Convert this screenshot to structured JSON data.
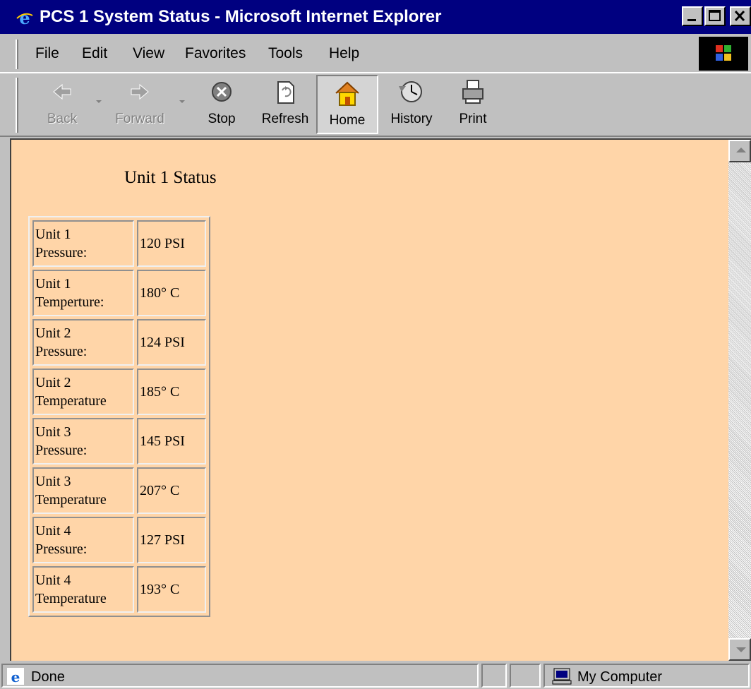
{
  "window": {
    "title": "PCS 1 System Status - Microsoft Internet Explorer"
  },
  "menu": [
    {
      "label": "File"
    },
    {
      "label": "Edit"
    },
    {
      "label": "View"
    },
    {
      "label": "Favorites"
    },
    {
      "label": "Tools"
    },
    {
      "label": "Help"
    }
  ],
  "toolbar": {
    "back": "Back",
    "forward": "Forward",
    "stop": "Stop",
    "refresh": "Refresh",
    "home": "Home",
    "history": "History",
    "print": "Print"
  },
  "page": {
    "heading": "Unit 1 Status",
    "background": "#ffd5a8",
    "rows": [
      {
        "label_line1": "Unit 1",
        "label_line2": "Pressure:",
        "value": "120 PSI"
      },
      {
        "label_line1": "Unit 1",
        "label_line2": "Temperture:",
        "value": "180° C"
      },
      {
        "label_line1": "Unit 2",
        "label_line2": "Pressure:",
        "value": "124 PSI"
      },
      {
        "label_line1": "Unit 2",
        "label_line2": "Temperature",
        "value": "185° C"
      },
      {
        "label_line1": "Unit 3",
        "label_line2": "Pressure:",
        "value": "145 PSI"
      },
      {
        "label_line1": "Unit 3",
        "label_line2": "Temperature",
        "value": "207° C"
      },
      {
        "label_line1": "Unit 4",
        "label_line2": "Pressure:",
        "value": "127 PSI"
      },
      {
        "label_line1": "Unit 4",
        "label_line2": "Temperature",
        "value": "193° C"
      }
    ]
  },
  "statusbar": {
    "status": "Done",
    "zone": "My Computer"
  }
}
